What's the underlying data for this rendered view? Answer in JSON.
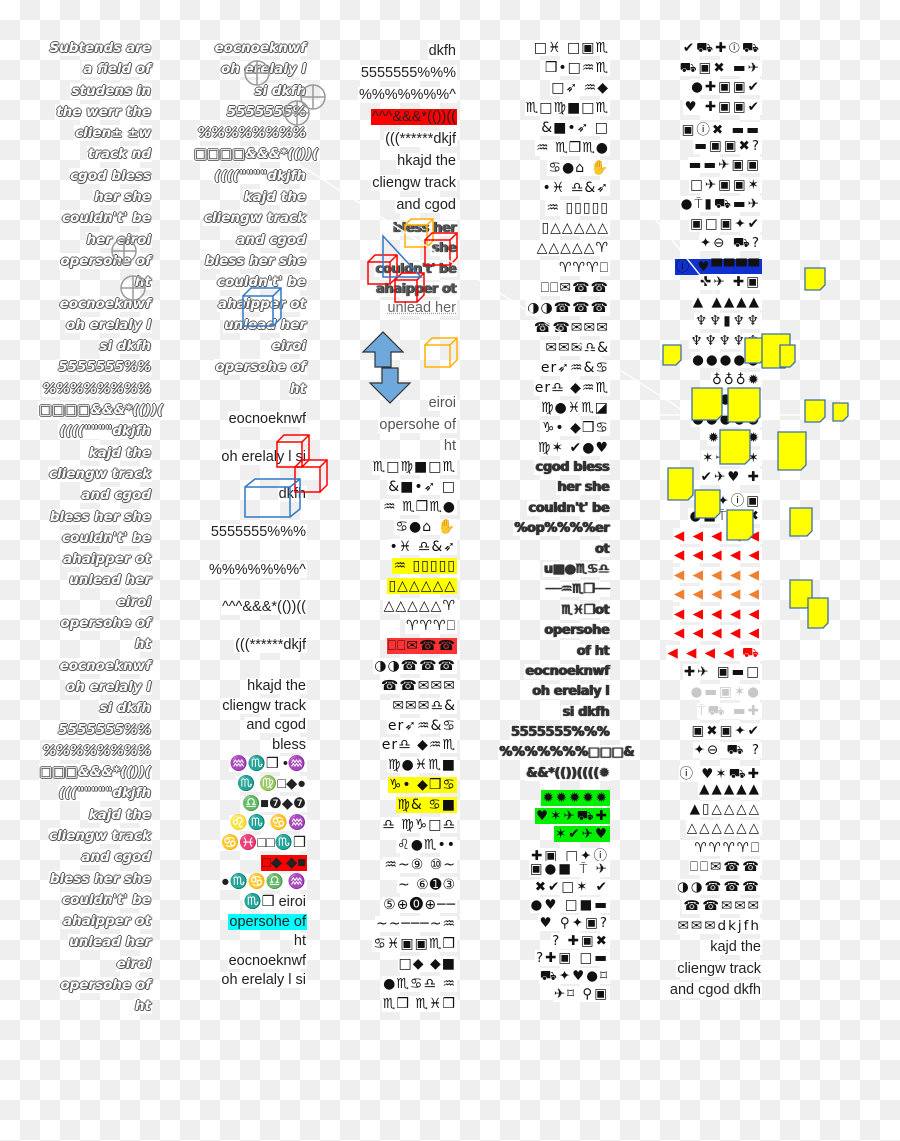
{
  "columns": [
    {
      "id": "col1",
      "segments": [
        {
          "style": "outline",
          "lines": [
            "Subtends are",
            "a field of",
            "studens in",
            "the werr the",
            "clien± ±w",
            "track   nd",
            "cgod bless",
            "her she",
            "couldn't' be",
            "her eiroi",
            "opersohe of",
            "ht",
            "eocnoeknwf",
            "oh erelaly l",
            "si dkfh",
            "5555555%%",
            "%%%%%%%%",
            "□□□□&&&*(())(",
            "((((\"\"\"\"dkjfh",
            "kajd the",
            "cliengw track",
            "and cgod",
            "bless her she",
            "couldn't' be",
            "ahaipper ot",
            "unlead her",
            "eiroi",
            "opersohe of",
            "ht",
            "eocnoeknwf",
            "oh erelaly l",
            "si dkfh",
            "5555555%%",
            "%%%%%%%%",
            "□□□&&&*(())(",
            "(((\"\"\"\"\"dkjfh",
            "kajd the",
            "cliengw track",
            "and cgod",
            "bless her she",
            "couldn't' be",
            "ahaipper ot",
            "unlead her",
            "eiroi",
            "opersohe of",
            "ht"
          ]
        }
      ]
    },
    {
      "id": "col2",
      "segments": [
        {
          "style": "outline",
          "lines": [
            "eocnoeknwf",
            "oh erelaly l",
            "si dkfh",
            "5555555%",
            "%%%%%%%%",
            "□□□□&&&*(())(",
            "((((\"\"\"\"dkjfh",
            "kajd the",
            "cliengw track",
            "and cgod",
            "bless her she",
            "couldn't' be",
            "ahaipper ot",
            "unlead her",
            "eiroi",
            "opersohe of",
            "ht"
          ]
        },
        {
          "style": "loose",
          "lines": [
            "eocnoeknwf",
            "oh erelaly l si",
            "dkfh",
            "5555555%%%",
            "%%%%%%%^",
            "^^^&&&*(())((",
            "(((******dkjf"
          ]
        },
        {
          "style": "plain",
          "lines": [
            "hkajd the",
            "cliengw track",
            "and cgod",
            "bless",
            "♒♏❒   •♒",
            "♏   ♍□◆●",
            "♎■❼◆❼",
            "♌♏   ♋♒",
            "♋♓□□♏❒",
            {
              "text": "□◆    ◆■",
              "bg": "#ff0000"
            },
            "●♏♋♎    ♒",
            "♏❒ eiroi",
            {
              "text": "opersohe of",
              "bg": "#00ffff"
            },
            "ht",
            "eocnoeknwf",
            "oh erelaly l si"
          ]
        }
      ]
    },
    {
      "id": "col3",
      "segments": [
        {
          "style": "plain",
          "lines": [
            "dkfh",
            "5555555%%%",
            "%%%%%%%^",
            {
              "text": "^^^&&&*(())((",
              "bg": "#ff0000"
            },
            "(((******dkjf",
            "hkajd the",
            "cliengw track",
            "and cgod"
          ]
        },
        {
          "style": "heavy",
          "lines": [
            "bless her",
            "she",
            "couldn't' be",
            "ahaipper ot"
          ]
        },
        {
          "style": "plain",
          "lines": [
            "unlead her"
          ]
        },
        {
          "style": "plain",
          "lines": [
            "eiroi",
            "opersohe of",
            "ht"
          ]
        },
        {
          "style": "wing",
          "lines": [
            "♏□♍■□♏",
            "&■•➶   □",
            "♒   ♏❒♏●",
            "♋●⌂   ✋",
            "•♓   ♎&➶",
            {
              "text": "♒   ▯▯▯▯▯",
              "bg": "#ffff00"
            },
            {
              "text": "▯△△△△△",
              "bg": "#ffff00"
            },
            "△△△△△♈",
            "♈♈♈⎕",
            {
              "text": "⎕⎕✉☎☎",
              "bg": "#ff3333"
            },
            "◑◑☎☎☎",
            "☎☎✉✉✉",
            "✉✉✉♎&",
            "er➶♒&♋",
            "er♎   ◆♒♏",
            "♍●♓♏■",
            {
              "text": "♑•   ◆❒♋",
              "bg": "#ffff00"
            },
            {
              "text": "♍&    ♋■",
              "bg": "#ffff00"
            },
            "♎   ♍♑□♎",
            "♌●♏••",
            "♒~⑨    ⑩~",
            "~    ⑥➊③",
            "⑤⊕⓿⊕──",
            "~~───~♒",
            "♋♓▣▣♏❒",
            "□◆     ◆■",
            "●♏♋♎    ♒",
            "♏❒    ♏♓❒"
          ]
        }
      ]
    },
    {
      "id": "col4",
      "segments": [
        {
          "style": "wing",
          "lines": [
            "□♓   □▣♏",
            "❒•□♒♏",
            "□➶    ♒◆",
            "♏□♍■□♏",
            "&■•➶   □",
            "♒   ♏❒♏●",
            "♋●⌂   ✋",
            "•♓   ♎&➶",
            "♒   ▯▯▯▯▯",
            "▯△△△△△",
            "△△△△△♈",
            "♈♈♈⎕",
            "⎕⎕✉☎☎",
            "◑◑☎☎☎",
            "☎☎✉✉✉",
            "✉✉✉♎&",
            "er➶♒&♋",
            "er♎   ◆♒♏",
            "♍●♓♏◪",
            "♑•    ◆❒♋",
            "♍✶   ✔●♥"
          ]
        },
        {
          "style": "heavy",
          "lines": [
            "cgod bless",
            "her she",
            "couldn't' be",
            "%op%%%%er",
            "ot",
            "u■●♏♋♎",
            "──♒♏❒──",
            "♏♓❒ot",
            "opersohe",
            "of ht",
            "eocnoeknwf",
            "oh erelaly l",
            "si dkfh",
            "5555555%%%",
            "%%%%%%%□□□&",
            "&&*(())((((✹"
          ]
        },
        {
          "style": "icons-tight",
          "lines": [
            {
              "text": "✹✹✹✹✹",
              "bg": "#00ee00"
            },
            {
              "text": "♥✶✈⛟✚",
              "bg": "#00ee00"
            },
            {
              "text": "✶✔✈♥",
              "bg": "#00ee00"
            },
            "✚▣  □✦ⓘ",
            "▣●■ ⍑  ✈",
            "✖✔□✶   ✔",
            "●♥  □■▬",
            "♥  ⚲✦▣?",
            "?  ✚▣✖",
            "?✚▣  □▬",
            "⛟✦♥●⌑",
            "✈⌑   ⚲▣"
          ]
        }
      ]
    },
    {
      "id": "col5",
      "segments": [
        {
          "style": "icons",
          "lines": [
            "✔⛟✚ⓘ⛟",
            "⛟▣✖ ▬✈",
            "●✚▣▣✔",
            "♥  ✚▣▣✔",
            "▣ⓘ✖  ▬▬",
            "▬▣▣✖?",
            "▬▬✈▣▣",
            "□✈▣▣✶",
            "●⍑▮⛟▬✈",
            "▣□▣✦✔",
            "✦⊖  ⛟?",
            {
              "text": "ⓘ ♥▀▀▀▀",
              "bg": "#1030d0"
            },
            "✚✈  ✚▣",
            "▲  ▲▲▲▲",
            "♆♆▮♆♆",
            "♆♆♆♆♆",
            "●●●●●",
            "♁♁♁✹",
            "●●●●●",
            "●●●●●",
            "✹✹✹✹",
            "✶✈⛟✶",
            "✔✈♥  ✚",
            "□✦ⓘ▣",
            "●■⍑ ✈✖",
            {
              "text": "◀ ◀ ◀ ◀ ◀",
              "color": "#ff0000"
            },
            {
              "text": "◀ ◀ ◀ ◀ ◀",
              "color": "#ff0000"
            },
            {
              "text": "◀ ◀ ◀ ◀ ◀",
              "color": "#f08030"
            },
            {
              "text": "◀ ◀ ◀ ◀ ◀",
              "color": "#f08030"
            },
            {
              "text": "◀ ◀ ◀ ◀ ◀",
              "color": "#ff0000"
            },
            {
              "text": "◀ ◀ ◀ ◀ ◀",
              "color": "#ff0000"
            },
            {
              "text": "◀ ◀ ◀ ◀ ⛟",
              "color": "#ff0000"
            },
            "✚✈  ▣▬□",
            {
              "text": "●▬▣✶●",
              "color": "#c8c8c8"
            },
            {
              "text": "⍑⛟  ▬✚",
              "color": "#c8c8c8"
            },
            "▣✖▣✦✔",
            "✦⊖  ⛟  ?",
            "ⓘ  ♥✶⛟✚",
            "▲▲▲▲▲",
            "▲▯△△△△",
            "△△△△△△",
            "♈♈♈♈⎕",
            "⎕⎕✉☎☎",
            "◑◑☎☎☎",
            "☎☎✉✉✉",
            "✉✉✉dkjfh"
          ]
        },
        {
          "style": "plain",
          "lines": [
            "kajd the",
            "cliengw track",
            "and cgod dkfh"
          ]
        }
      ]
    }
  ],
  "colors": {
    "note_yellow": "#ffff00",
    "note_border": "#3d6fa8",
    "cube_red": "#ff0000",
    "cube_blue": "#2f78c8",
    "cube_orange": "#ffb000",
    "arrow_blue": "#6fa8dc"
  }
}
